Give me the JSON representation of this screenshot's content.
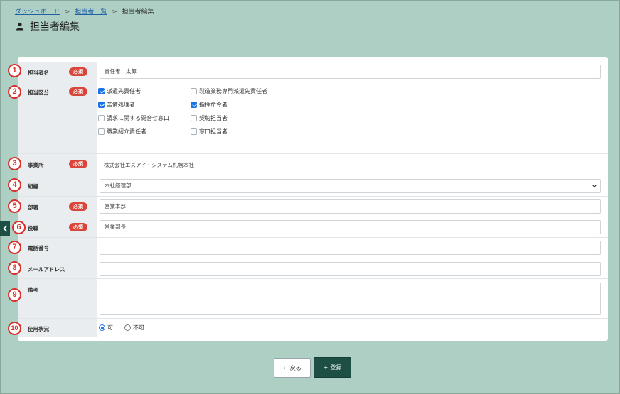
{
  "breadcrumb": {
    "items": [
      "ダッシュボード",
      "担当者一覧"
    ],
    "separator": ">",
    "current": "担当者編集"
  },
  "page": {
    "title": "担当者編集",
    "icon": "person-icon"
  },
  "required_badge": "必須",
  "form": {
    "tantousha_mei": {
      "label": "担当者名",
      "value": "責任者　太郎"
    },
    "tantou_kubun": {
      "label": "担当区分",
      "options": [
        {
          "label": "派遣先責任者",
          "checked": true
        },
        {
          "label": "製造業務専門派遣先責任者",
          "checked": false
        },
        {
          "label": "苦情処理者",
          "checked": true
        },
        {
          "label": "指揮命令者",
          "checked": true
        },
        {
          "label": "請求に関する問合せ窓口",
          "checked": false
        },
        {
          "label": "契約担当者",
          "checked": false
        },
        {
          "label": "職業紹介責任者",
          "checked": false
        },
        {
          "label": "窓口担当者",
          "checked": false
        }
      ]
    },
    "jigyousho": {
      "label": "事業所",
      "value": "株式会社エスアイ・システム札幌本社"
    },
    "soshiki": {
      "label": "組織",
      "value": "本社経理部"
    },
    "busho": {
      "label": "部署",
      "value": "営業本部"
    },
    "yakushoku": {
      "label": "役職",
      "value": "営業部長"
    },
    "denwa": {
      "label": "電話番号",
      "value": ""
    },
    "email": {
      "label": "メールアドレス",
      "value": ""
    },
    "bikou": {
      "label": "備考",
      "value": ""
    },
    "shiyou": {
      "label": "使用状況",
      "options": [
        {
          "label": "可",
          "selected": true
        },
        {
          "label": "不可",
          "selected": false
        }
      ]
    }
  },
  "markers": [
    "1",
    "2",
    "3",
    "4",
    "5",
    "6",
    "7",
    "8",
    "9",
    "10"
  ],
  "buttons": {
    "back": "戻る",
    "back_icon": "←",
    "save": "登録",
    "save_icon": "+"
  },
  "colors": {
    "background": "#aed0c4",
    "required": "#d9453a",
    "primary": "#1d4f45",
    "marker": "#d9302a",
    "check": "#1a73e8"
  }
}
